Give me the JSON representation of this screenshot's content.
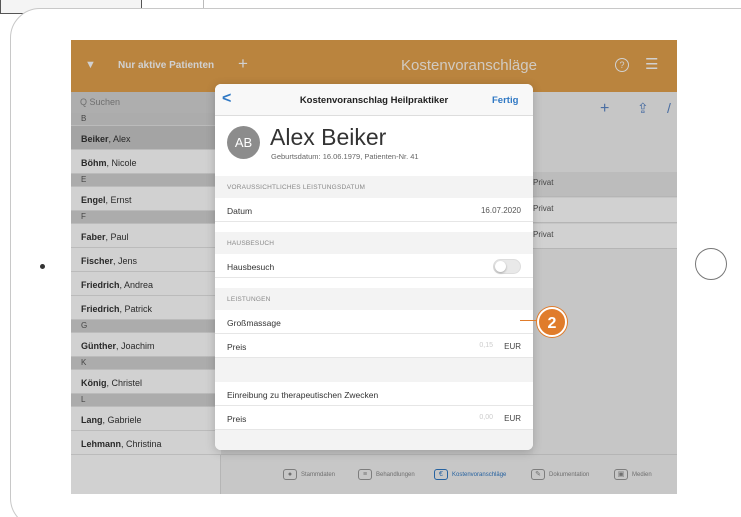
{
  "nav": {
    "filter_label": "Nur aktive Patienten",
    "plus_glyph": "+",
    "title": "Kostenvoranschläge",
    "help_glyph": "?",
    "list_glyph": "☰",
    "filter_icon": "funnel-icon"
  },
  "search": {
    "placeholder": "Q Suchen"
  },
  "patients": [
    {
      "type": "header",
      "text": "B"
    },
    {
      "type": "patient",
      "last": "Beiker",
      "first": ", Alex",
      "selected": true
    },
    {
      "type": "patient",
      "last": "Böhm",
      "first": ", Nicole"
    },
    {
      "type": "header",
      "text": "E"
    },
    {
      "type": "patient",
      "last": "Engel",
      "first": ", Ernst"
    },
    {
      "type": "header",
      "text": "F"
    },
    {
      "type": "patient",
      "last": "Faber",
      "first": ", Paul"
    },
    {
      "type": "patient",
      "last": "Fischer",
      "first": ", Jens"
    },
    {
      "type": "patient",
      "last": "Friedrich",
      "first": ", Andrea"
    },
    {
      "type": "patient",
      "last": "Friedrich",
      "first": ", Patrick"
    },
    {
      "type": "header",
      "text": "G"
    },
    {
      "type": "patient",
      "last": "Günther",
      "first": ", Joachim"
    },
    {
      "type": "header",
      "text": "K"
    },
    {
      "type": "patient",
      "last": "König",
      "first": ", Christel"
    },
    {
      "type": "header",
      "text": "L"
    },
    {
      "type": "patient",
      "last": "Lang",
      "first": ", Gabriele"
    },
    {
      "type": "patient",
      "last": "Lehmann",
      "first": ", Christina"
    }
  ],
  "right_panel": {
    "share_glyph": "⇪",
    "add_glyph": "+",
    "edit_glyph": "/",
    "rows": [
      "Privat",
      "Privat",
      "Privat"
    ]
  },
  "tabbar": {
    "items": [
      {
        "label": "Stammdaten",
        "icon": "person-icon"
      },
      {
        "label": "Behandlungen",
        "icon": "card-icon"
      },
      {
        "label": "Kostenvoranschläge",
        "icon": "estimate-icon",
        "active": true
      },
      {
        "label": "Dokumentation",
        "icon": "doc-icon"
      },
      {
        "label": "Medien",
        "icon": "media-icon"
      }
    ]
  },
  "modal": {
    "back_glyph": "<",
    "title": "Kostenvoranschlag Heilpraktiker",
    "done": "Fertig",
    "avatar_initials": "AB",
    "patient_name": "Alex Beiker",
    "patient_sub": "Geburtsdatum: 16.06.1979, Patienten-Nr. 41",
    "section_date": "VORAUSSICHTLICHES LEISTUNGSDATUM",
    "date_label": "Datum",
    "date_value": "16.07.2020",
    "section_visit": "HAUSBESUCH",
    "visit_label": "Hausbesuch",
    "visit_on": false,
    "section_services": "LEISTUNGEN",
    "service1_name": "Großmassage",
    "service1_price_label": "Preis",
    "service1_price_placeholder": "0,15",
    "service1_unit": "EUR",
    "service2_name": "Einreibung zu therapeutischen Zwecken",
    "service2_price_label": "Preis",
    "service2_price_placeholder": "0,00",
    "service2_unit": "EUR"
  },
  "callout": {
    "number": "2",
    "color": "#e07c2b"
  },
  "colors": {
    "nav": "#e3a14c",
    "accent": "#2f78c4"
  }
}
